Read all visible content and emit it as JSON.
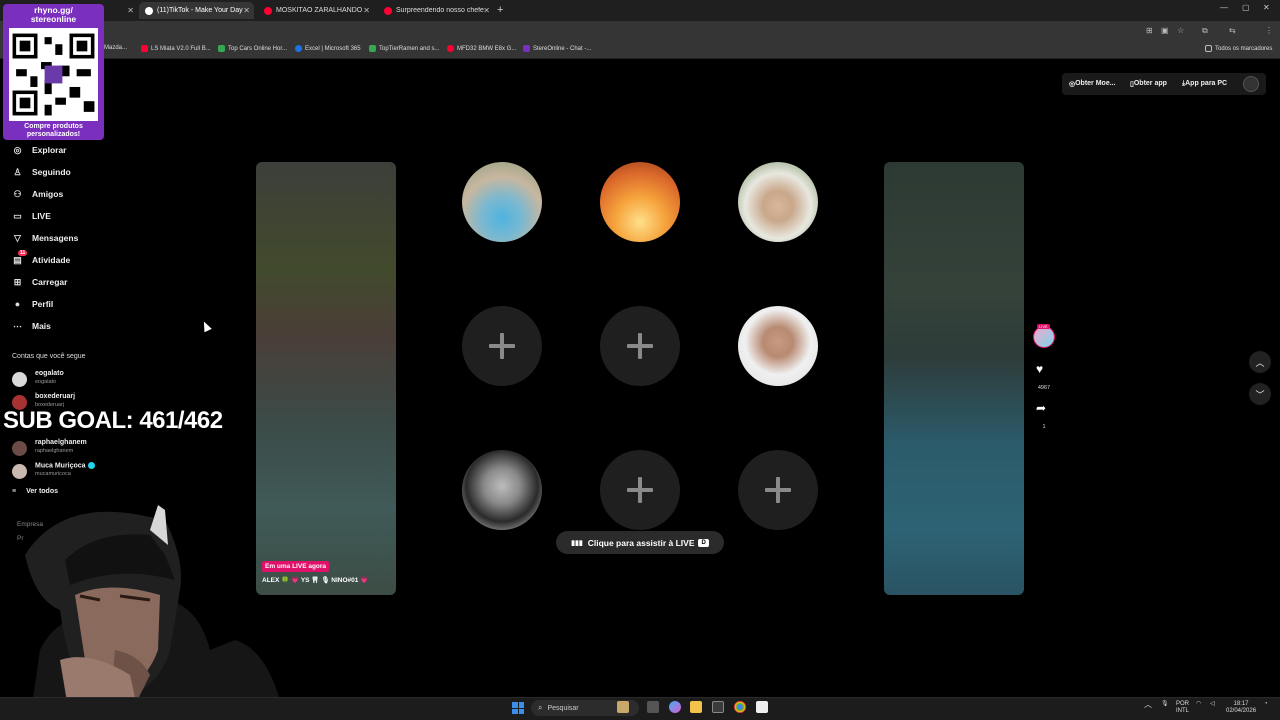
{
  "browser": {
    "tabs": [
      {
        "title": "TikTok - Make Your Day",
        "count": "(11)",
        "fav_color": "#ffffff",
        "active": true
      },
      {
        "title": "MOSKITAO ZARALHANDO AS",
        "fav_color": "#ff0033"
      },
      {
        "title": "Surpreendendo nosso chefe co",
        "fav_color": "#ff0033"
      }
    ],
    "bookmarks": [
      {
        "label": "Mazda...",
        "color": "#888888"
      },
      {
        "label": "LS Miata V2.0 Full B...",
        "color": "#ff0033"
      },
      {
        "label": "Top Cars Online Hor...",
        "color": "#34a853"
      },
      {
        "label": "Excel | Microsoft 365",
        "color": "#1a73e8"
      },
      {
        "label": "TopTierRamen and s...",
        "color": "#34a853"
      },
      {
        "label": "MFD32 BMW E8x G...",
        "color": "#ff0033"
      },
      {
        "label": "StereOnline - Chat -...",
        "color": "#7b2fbe"
      }
    ],
    "all_bookmarks": "Todos os marcadores"
  },
  "header": {
    "coins": "Obter Moe...",
    "get_app": "Obter app",
    "pc_app": "App para PC"
  },
  "sidebar": {
    "nav": [
      {
        "label": "Explorar",
        "icon": "compass-icon"
      },
      {
        "label": "Seguindo",
        "icon": "following-icon"
      },
      {
        "label": "Amigos",
        "icon": "friends-icon"
      },
      {
        "label": "LIVE",
        "icon": "live-icon"
      },
      {
        "label": "Mensagens",
        "icon": "messages-icon"
      },
      {
        "label": "Atividade",
        "icon": "activity-icon",
        "badge": "11"
      },
      {
        "label": "Carregar",
        "icon": "upload-icon"
      },
      {
        "label": "Perfil",
        "icon": "profile-icon"
      },
      {
        "label": "Mais",
        "icon": "more-icon"
      }
    ],
    "following_title": "Contas que você segue",
    "accounts": [
      {
        "name": "eogalato",
        "handle": "eogalato"
      },
      {
        "name": "boxederuarj",
        "handle": "boxederuarj"
      },
      {
        "name": "raphaelghanem",
        "handle": "raphaelghanem"
      },
      {
        "name": "Muca Muriçoca",
        "handle": "mucamuricoca",
        "verified": true
      }
    ],
    "see_all": "Ver todos",
    "footer": [
      "Empresa",
      "Pr"
    ]
  },
  "overlay": {
    "qr_title_1": "rhyno.gg/",
    "qr_title_2": "stereonline",
    "qr_caption_1": "Compre produtos",
    "qr_caption_2": "personalizados!",
    "subgoal": "SUB GOAL: 461/462"
  },
  "live": {
    "now_label": "Em uma LIVE agora",
    "host": "ALEX 🍀 💗 YS 🦷 🎙 NINO#01 💗",
    "watch_label": "Clique para assistir à LIVE",
    "watch_key": "D",
    "tag": "LIVE"
  },
  "actions": {
    "likes": "4967",
    "shares": "1"
  },
  "taskbar": {
    "search": "Pesquisar",
    "lang_1": "POR",
    "lang_2": "INTL",
    "time": "18:17",
    "date": "02/04/2026"
  }
}
